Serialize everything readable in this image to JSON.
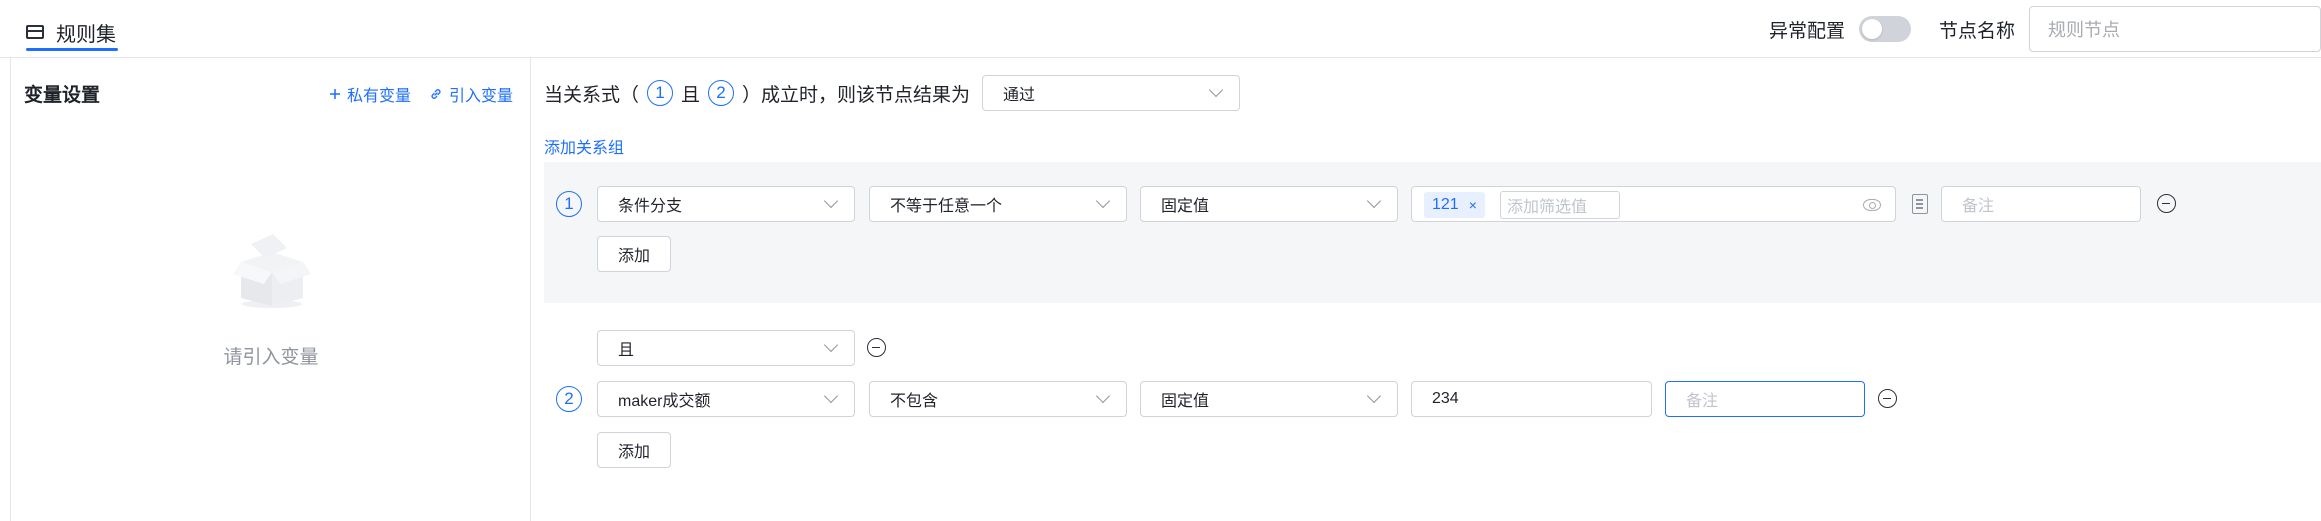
{
  "header": {
    "tab_label": "规则集",
    "exception_label": "异常配置",
    "exception_enabled": false,
    "node_name_label": "节点名称",
    "node_name_placeholder": "规则节点"
  },
  "sidebar": {
    "title": "变量设置",
    "private_var_label": "私有变量",
    "import_var_label": "引入变量",
    "empty_text": "请引入变量"
  },
  "main": {
    "cond_prefix": "当关系式（",
    "cond_num1": "1",
    "cond_and": "且",
    "cond_num2": "2",
    "cond_suffix": "）成立时，则该节点结果为",
    "result_value": "通过",
    "add_group_label": "添加关系组",
    "group1": {
      "index": "1",
      "field": "条件分支",
      "operator": "不等于任意一个",
      "value_type": "固定值",
      "tags": [
        "121"
      ],
      "filter_placeholder": "添加筛选值",
      "note_placeholder": "备注",
      "add_label": "添加"
    },
    "group2": {
      "connector": "且",
      "index": "2",
      "field": "maker成交额",
      "operator": "不包含",
      "value_type": "固定值",
      "value": "234",
      "note_placeholder": "备注",
      "add_label": "添加"
    }
  },
  "colors": {
    "accent": "#1e6fff",
    "group_bg": "#f5f6f7",
    "border": "#d0d3d9"
  }
}
